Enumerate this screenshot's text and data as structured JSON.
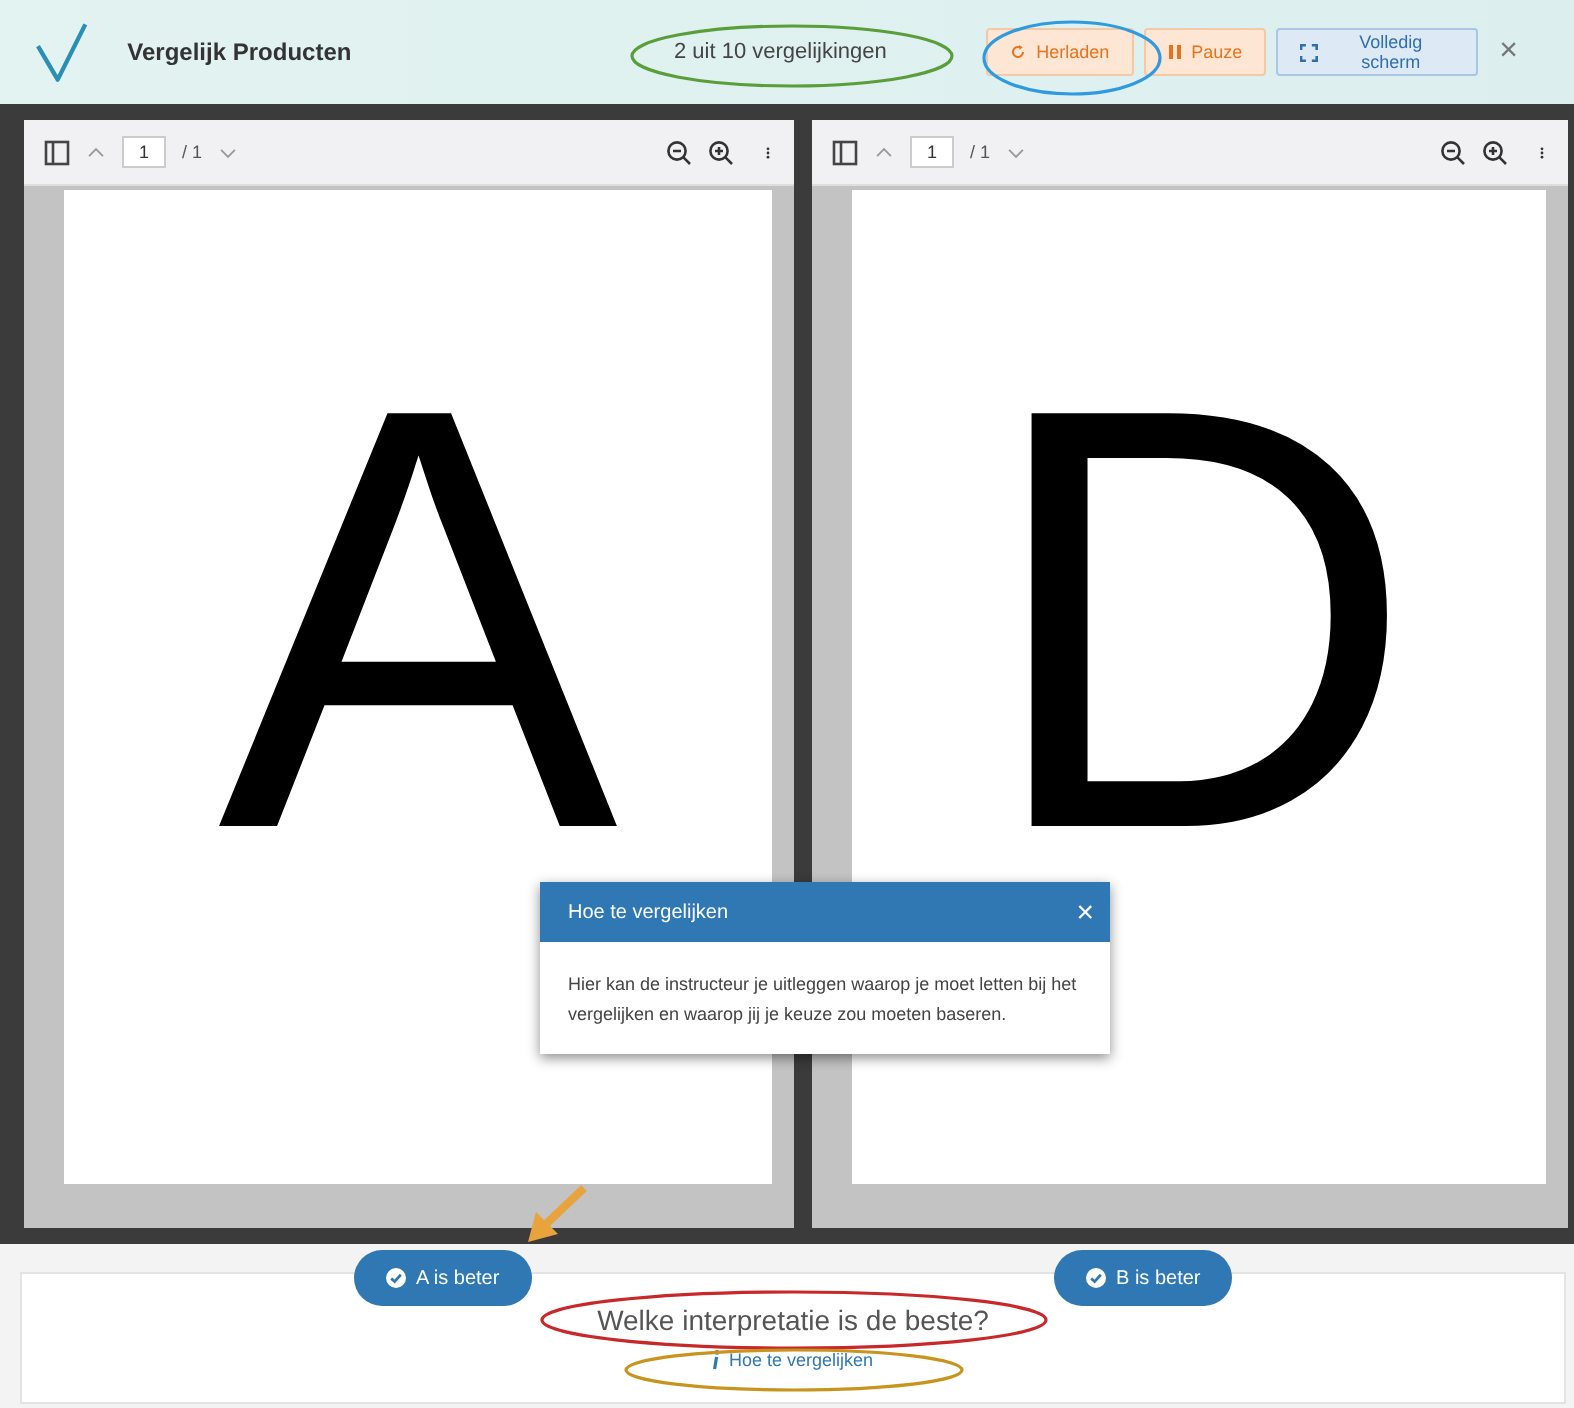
{
  "header": {
    "title": "Vergelijk Producten",
    "progress": "2 uit 10 vergelijkingen",
    "buttons": [
      {
        "kind": "reload",
        "label": "Herladen"
      },
      {
        "kind": "pause",
        "label": "Pauze"
      },
      {
        "kind": "fullscreen",
        "label": "Volledig scherm"
      }
    ],
    "close": "×"
  },
  "viewers": [
    {
      "page_input": "1",
      "page_total": "/ 1",
      "page_text": "A"
    },
    {
      "page_input": "1",
      "page_total": "/ 1",
      "page_text": "D"
    }
  ],
  "dialog": {
    "title": "Hoe te vergelijken",
    "close": "×",
    "body": "Hier kan de instructeur je uitleggen waarop je moet letten bij het vergelijken en waarop jij je keuze zou moeten baseren."
  },
  "choices": [
    "A is beter",
    "B is beter"
  ],
  "question": "Welke interpretatie is de beste?",
  "help_link": "Hoe te vergelijken",
  "annotations": [
    {
      "kind": "ellipse",
      "color": "#5a9e3c"
    },
    {
      "kind": "ellipse",
      "color": "#2f9ae0"
    },
    {
      "kind": "ellipse",
      "color": "#c8282a"
    },
    {
      "kind": "ellipse",
      "color": "#c8941e"
    },
    {
      "kind": "arrow",
      "color": "#e8a33c"
    }
  ]
}
